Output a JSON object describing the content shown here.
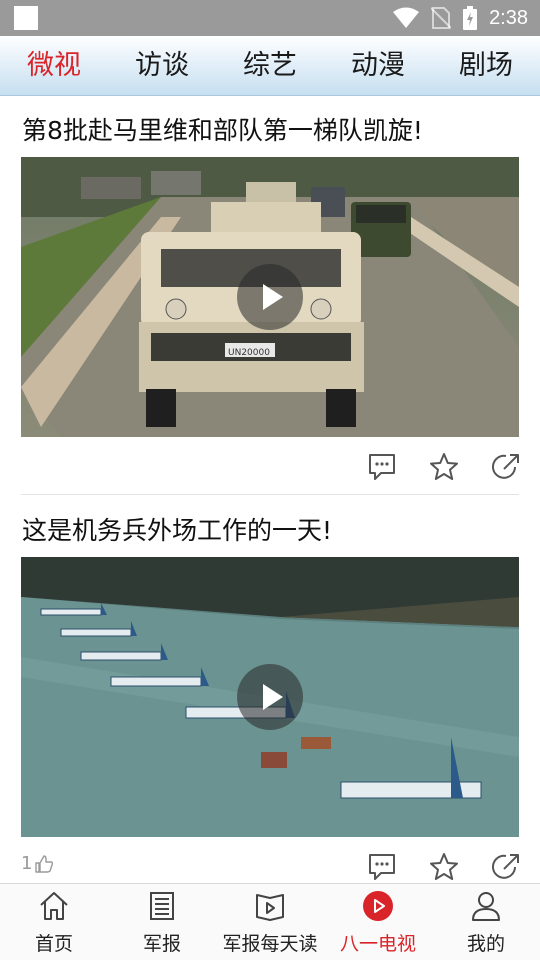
{
  "status_bar": {
    "time": "2:38"
  },
  "tabs": [
    {
      "label": "微视",
      "active": true
    },
    {
      "label": "访谈",
      "active": false
    },
    {
      "label": "综艺",
      "active": false
    },
    {
      "label": "动漫",
      "active": false
    },
    {
      "label": "剧场",
      "active": false
    }
  ],
  "feed": {
    "cards": [
      {
        "title": "第8批赴马里维和部队第一梯队凯旋!",
        "plate": "UN20000"
      },
      {
        "title": "这是机务兵外场工作的一天!",
        "likes": "1"
      }
    ]
  },
  "bottom_nav": [
    {
      "label": "首页",
      "icon": "home-icon"
    },
    {
      "label": "军报",
      "icon": "newspaper-icon"
    },
    {
      "label": "军报每天读",
      "icon": "book-play-icon"
    },
    {
      "label": "八一电视",
      "icon": "play-circle-icon",
      "active": true
    },
    {
      "label": "我的",
      "icon": "user-icon"
    }
  ],
  "colors": {
    "accent": "#d9252a",
    "status_bar": "#9a9a9a"
  }
}
